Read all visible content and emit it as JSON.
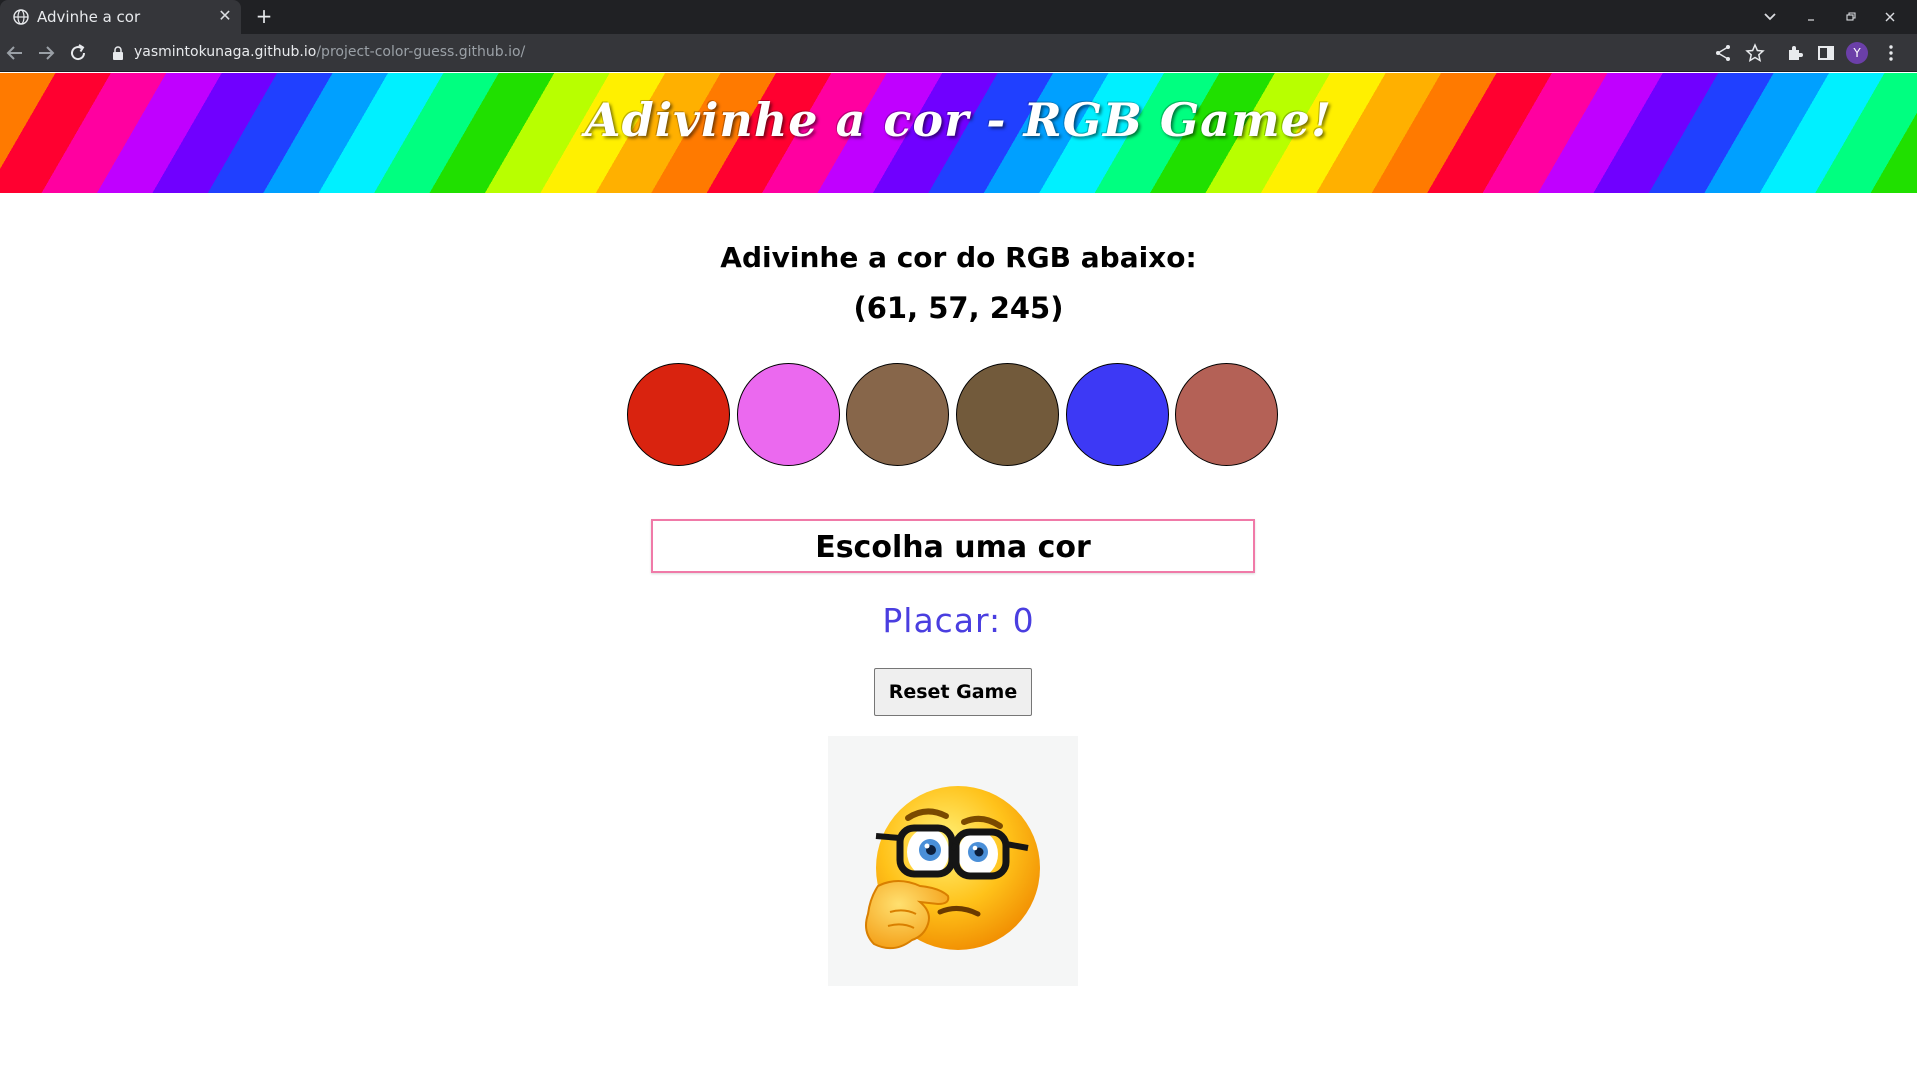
{
  "browser": {
    "tab_title": "Advinhe a cor",
    "tab_close": "✕",
    "new_tab": "+",
    "url_host": "yasmintokunaga.github.io",
    "url_path": "/project-color-guess.github.io/",
    "avatar_letter": "Y",
    "icons": [
      "globe-icon",
      "back-icon",
      "forward-icon",
      "reload-icon",
      "lock-icon",
      "share-icon",
      "star-icon",
      "extensions-icon",
      "side-panel-icon",
      "menu-icon",
      "tab-list-icon",
      "minimize-icon",
      "restore-icon",
      "close-icon"
    ]
  },
  "page": {
    "banner_title": "Adivinhe a cor - RGB Game!",
    "question": "Adivinhe a cor do RGB abaixo:",
    "rgb_text": "(61, 57, 245)",
    "balls": [
      {
        "color": "#d9230f"
      },
      {
        "color": "#eb69ef"
      },
      {
        "color": "#87664a"
      },
      {
        "color": "#725a3b"
      },
      {
        "color": "#3d39f5"
      },
      {
        "color": "#b46156"
      }
    ],
    "answer": "Escolha uma cor",
    "score": "Placar: 0",
    "reset_button": "Reset Game",
    "image": "thinking-face-with-glasses-emoji"
  },
  "colors": {
    "score_color": "#4a3ee0",
    "answer_border": "#f07aa8",
    "chrome_dark": "#202124",
    "chrome_tab": "#35363a"
  }
}
